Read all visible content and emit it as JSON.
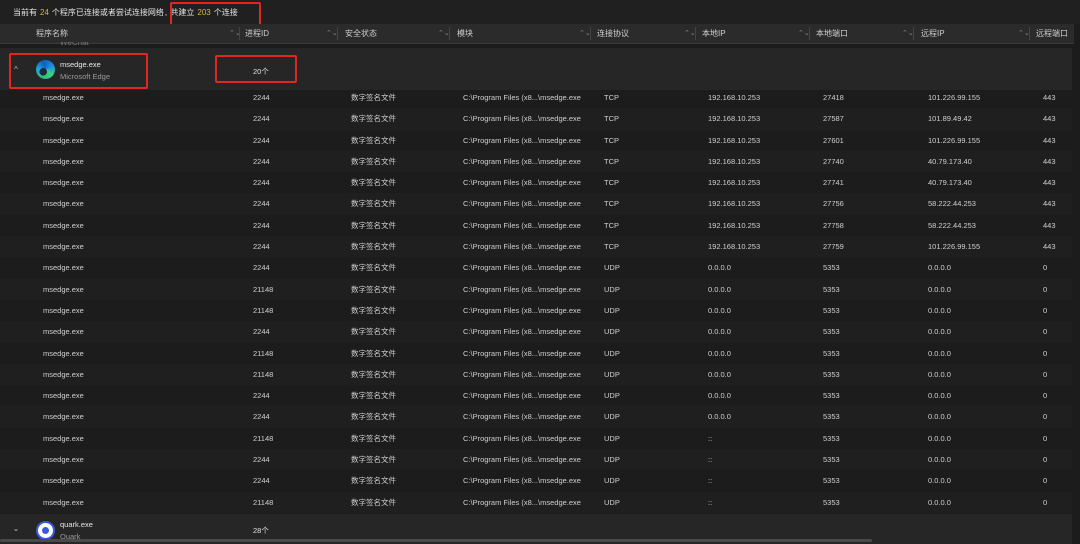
{
  "summary": {
    "prefix": "当前有",
    "program_count": "24",
    "mid": "个程序已连接或者尝试连接网络",
    "sep": ",",
    "total_prefix": "共建立",
    "connection_count": "203",
    "total_suffix": "个连接"
  },
  "columns": {
    "program": "程序名称",
    "pid": "进程ID",
    "security": "安全状态",
    "module": "模块",
    "protocol": "连接协议",
    "local_ip": "本地IP",
    "local_port": "本地端口",
    "remote_ip": "远程IP",
    "remote_port": "远程端口"
  },
  "ghost_group_label": "WeChat",
  "groups": [
    {
      "name": "msedge.exe",
      "subtitle": "Microsoft Edge",
      "count": "20个",
      "expanded": true,
      "chevron": "^",
      "icon": "edge-icon"
    },
    {
      "name": "quark.exe",
      "subtitle": "Quark",
      "count": "28个",
      "expanded": false,
      "chevron": "⌄",
      "icon": "quark-icon"
    }
  ],
  "rows": [
    {
      "name": "msedge.exe",
      "pid": "2244",
      "security": "数字签名文件",
      "module": "C:\\Program Files (x8...\\msedge.exe",
      "protocol": "TCP",
      "local_ip": "192.168.10.253",
      "local_port": "27418",
      "remote_ip": "101.226.99.155",
      "remote_port": "443"
    },
    {
      "name": "msedge.exe",
      "pid": "2244",
      "security": "数字签名文件",
      "module": "C:\\Program Files (x8...\\msedge.exe",
      "protocol": "TCP",
      "local_ip": "192.168.10.253",
      "local_port": "27587",
      "remote_ip": "101.89.49.42",
      "remote_port": "443"
    },
    {
      "name": "msedge.exe",
      "pid": "2244",
      "security": "数字签名文件",
      "module": "C:\\Program Files (x8...\\msedge.exe",
      "protocol": "TCP",
      "local_ip": "192.168.10.253",
      "local_port": "27601",
      "remote_ip": "101.226.99.155",
      "remote_port": "443"
    },
    {
      "name": "msedge.exe",
      "pid": "2244",
      "security": "数字签名文件",
      "module": "C:\\Program Files (x8...\\msedge.exe",
      "protocol": "TCP",
      "local_ip": "192.168.10.253",
      "local_port": "27740",
      "remote_ip": "40.79.173.40",
      "remote_port": "443"
    },
    {
      "name": "msedge.exe",
      "pid": "2244",
      "security": "数字签名文件",
      "module": "C:\\Program Files (x8...\\msedge.exe",
      "protocol": "TCP",
      "local_ip": "192.168.10.253",
      "local_port": "27741",
      "remote_ip": "40.79.173.40",
      "remote_port": "443"
    },
    {
      "name": "msedge.exe",
      "pid": "2244",
      "security": "数字签名文件",
      "module": "C:\\Program Files (x8...\\msedge.exe",
      "protocol": "TCP",
      "local_ip": "192.168.10.253",
      "local_port": "27756",
      "remote_ip": "58.222.44.253",
      "remote_port": "443"
    },
    {
      "name": "msedge.exe",
      "pid": "2244",
      "security": "数字签名文件",
      "module": "C:\\Program Files (x8...\\msedge.exe",
      "protocol": "TCP",
      "local_ip": "192.168.10.253",
      "local_port": "27758",
      "remote_ip": "58.222.44.253",
      "remote_port": "443"
    },
    {
      "name": "msedge.exe",
      "pid": "2244",
      "security": "数字签名文件",
      "module": "C:\\Program Files (x8...\\msedge.exe",
      "protocol": "TCP",
      "local_ip": "192.168.10.253",
      "local_port": "27759",
      "remote_ip": "101.226.99.155",
      "remote_port": "443"
    },
    {
      "name": "msedge.exe",
      "pid": "2244",
      "security": "数字签名文件",
      "module": "C:\\Program Files (x8...\\msedge.exe",
      "protocol": "UDP",
      "local_ip": "0.0.0.0",
      "local_port": "5353",
      "remote_ip": "0.0.0.0",
      "remote_port": "0"
    },
    {
      "name": "msedge.exe",
      "pid": "21148",
      "security": "数字签名文件",
      "module": "C:\\Program Files (x8...\\msedge.exe",
      "protocol": "UDP",
      "local_ip": "0.0.0.0",
      "local_port": "5353",
      "remote_ip": "0.0.0.0",
      "remote_port": "0"
    },
    {
      "name": "msedge.exe",
      "pid": "21148",
      "security": "数字签名文件",
      "module": "C:\\Program Files (x8...\\msedge.exe",
      "protocol": "UDP",
      "local_ip": "0.0.0.0",
      "local_port": "5353",
      "remote_ip": "0.0.0.0",
      "remote_port": "0"
    },
    {
      "name": "msedge.exe",
      "pid": "2244",
      "security": "数字签名文件",
      "module": "C:\\Program Files (x8...\\msedge.exe",
      "protocol": "UDP",
      "local_ip": "0.0.0.0",
      "local_port": "5353",
      "remote_ip": "0.0.0.0",
      "remote_port": "0"
    },
    {
      "name": "msedge.exe",
      "pid": "21148",
      "security": "数字签名文件",
      "module": "C:\\Program Files (x8...\\msedge.exe",
      "protocol": "UDP",
      "local_ip": "0.0.0.0",
      "local_port": "5353",
      "remote_ip": "0.0.0.0",
      "remote_port": "0"
    },
    {
      "name": "msedge.exe",
      "pid": "21148",
      "security": "数字签名文件",
      "module": "C:\\Program Files (x8...\\msedge.exe",
      "protocol": "UDP",
      "local_ip": "0.0.0.0",
      "local_port": "5353",
      "remote_ip": "0.0.0.0",
      "remote_port": "0"
    },
    {
      "name": "msedge.exe",
      "pid": "2244",
      "security": "数字签名文件",
      "module": "C:\\Program Files (x8...\\msedge.exe",
      "protocol": "UDP",
      "local_ip": "0.0.0.0",
      "local_port": "5353",
      "remote_ip": "0.0.0.0",
      "remote_port": "0"
    },
    {
      "name": "msedge.exe",
      "pid": "2244",
      "security": "数字签名文件",
      "module": "C:\\Program Files (x8...\\msedge.exe",
      "protocol": "UDP",
      "local_ip": "0.0.0.0",
      "local_port": "5353",
      "remote_ip": "0.0.0.0",
      "remote_port": "0"
    },
    {
      "name": "msedge.exe",
      "pid": "21148",
      "security": "数字签名文件",
      "module": "C:\\Program Files (x8...\\msedge.exe",
      "protocol": "UDP",
      "local_ip": "::",
      "local_port": "5353",
      "remote_ip": "0.0.0.0",
      "remote_port": "0"
    },
    {
      "name": "msedge.exe",
      "pid": "2244",
      "security": "数字签名文件",
      "module": "C:\\Program Files (x8...\\msedge.exe",
      "protocol": "UDP",
      "local_ip": "::",
      "local_port": "5353",
      "remote_ip": "0.0.0.0",
      "remote_port": "0"
    },
    {
      "name": "msedge.exe",
      "pid": "2244",
      "security": "数字签名文件",
      "module": "C:\\Program Files (x8...\\msedge.exe",
      "protocol": "UDP",
      "local_ip": "::",
      "local_port": "5353",
      "remote_ip": "0.0.0.0",
      "remote_port": "0"
    },
    {
      "name": "msedge.exe",
      "pid": "21148",
      "security": "数字签名文件",
      "module": "C:\\Program Files (x8...\\msedge.exe",
      "protocol": "UDP",
      "local_ip": "::",
      "local_port": "5353",
      "remote_ip": "0.0.0.0",
      "remote_port": "0"
    }
  ],
  "colors": {
    "accent_number": "#d8b24a",
    "highlight_box": "#e0281f",
    "background": "#1c1c1c"
  }
}
